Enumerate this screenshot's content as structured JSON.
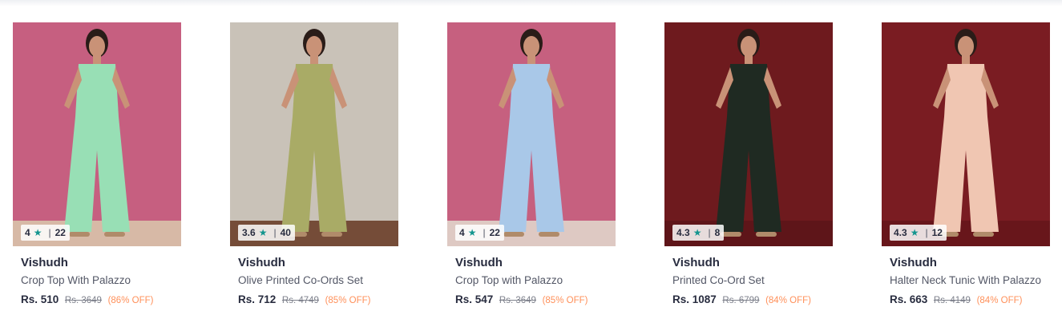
{
  "products": [
    {
      "rating": "4",
      "count": "22",
      "brand": "Vishudh",
      "name": "Crop Top With Palazzo",
      "price": "Rs. 510",
      "mrp": "Rs. 3649",
      "discount": "(86% OFF)",
      "bg": "#c65f80",
      "outfit": "#98dfb5",
      "floor": "#d8c3aa"
    },
    {
      "rating": "3.6",
      "count": "40",
      "brand": "Vishudh",
      "name": "Olive Printed Co-Ords Set",
      "price": "Rs. 712",
      "mrp": "Rs. 4749",
      "discount": "(85% OFF)",
      "bg": "#c9c2b8",
      "outfit": "#a9ab66",
      "floor": "#6b3f2a"
    },
    {
      "rating": "4",
      "count": "22",
      "brand": "Vishudh",
      "name": "Crop Top with Palazzo",
      "price": "Rs. 547",
      "mrp": "Rs. 3649",
      "discount": "(85% OFF)",
      "bg": "#c6607f",
      "outfit": "#a9c8e8",
      "floor": "#e0d5cb"
    },
    {
      "rating": "4.3",
      "count": "8",
      "brand": "Vishudh",
      "name": "Printed Co-Ord Set",
      "price": "Rs. 1087",
      "mrp": "Rs. 6799",
      "discount": "(84% OFF)",
      "bg": "#6e1a1e",
      "outfit": "#1f2a22",
      "floor": "#5c1518"
    },
    {
      "rating": "4.3",
      "count": "12",
      "brand": "Vishudh",
      "name": "Halter Neck Tunic With Palazzo",
      "price": "Rs. 663",
      "mrp": "Rs. 4149",
      "discount": "(84% OFF)",
      "bg": "#7a1c22",
      "outfit": "#f0c6b2",
      "floor": "#66161b"
    }
  ],
  "colors": {
    "star": "#14958f",
    "discount": "#ff905a"
  },
  "icons": {
    "rating": "star-icon"
  }
}
